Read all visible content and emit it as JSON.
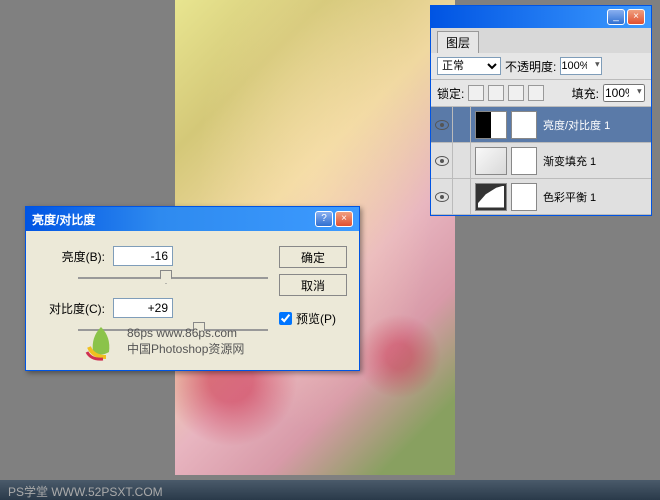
{
  "app": {
    "status_bar": "PS学堂 WWW.52PSXT.COM"
  },
  "bc_dialog": {
    "title": "亮度/对比度",
    "brightness_label": "亮度(B):",
    "brightness_value": "-16",
    "contrast_label": "对比度(C):",
    "contrast_value": "+29",
    "ok": "确定",
    "cancel": "取消",
    "preview": "预览(P)",
    "watermark_site": "86ps  www.86ps.com",
    "watermark_sub": "中国Photoshop资源网"
  },
  "layers_panel": {
    "tab": "图层",
    "blend_mode": "正常",
    "opacity_label": "不透明度:",
    "opacity_value": "100%",
    "lock_label": "锁定:",
    "fill_label": "填充:",
    "fill_value": "100%",
    "rows": [
      {
        "name": "亮度/对比度 1",
        "selected": true,
        "thumb": "adj"
      },
      {
        "name": "渐变填充 1",
        "selected": false,
        "thumb": "grad"
      },
      {
        "name": "色彩平衡 1",
        "selected": false,
        "thumb": "curve"
      }
    ]
  }
}
